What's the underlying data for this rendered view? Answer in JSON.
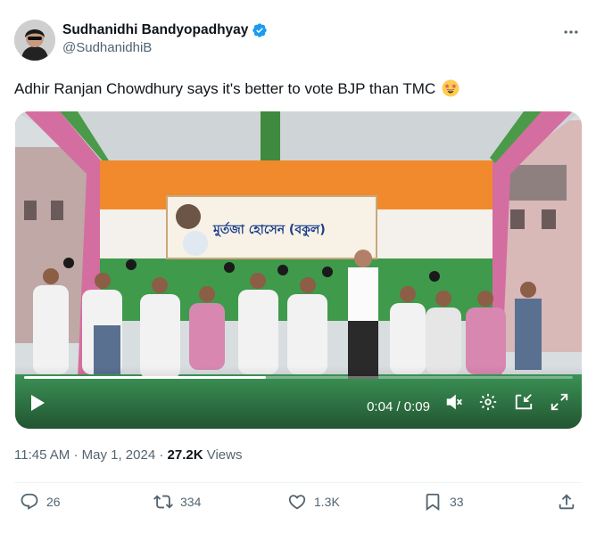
{
  "author": {
    "display_name": "Sudhanidhi Bandyopadhyay",
    "handle": "@SudhanidhiB",
    "verified": true
  },
  "more_icon": "more-dots-icon",
  "tweet": {
    "text": "Adhir Ranjan Chowdhury says it's better to vote BJP than TMC",
    "emoji": "star-struck-emoji"
  },
  "video": {
    "time_display": "0:04 / 0:09",
    "progress": 0.44,
    "banner_text": "মুর্তজা হোসেন (বকুল)"
  },
  "meta": {
    "time": "11:45 AM",
    "separator": "·",
    "date": "May 1, 2024",
    "views_count": "27.2K",
    "views_label": "Views"
  },
  "actions": {
    "replies": "26",
    "reposts": "334",
    "likes": "1.3K",
    "bookmarks": "33"
  },
  "colors": {
    "verified": "#1d9bf0",
    "text_secondary": "#536471",
    "text_primary": "#0f1419"
  }
}
